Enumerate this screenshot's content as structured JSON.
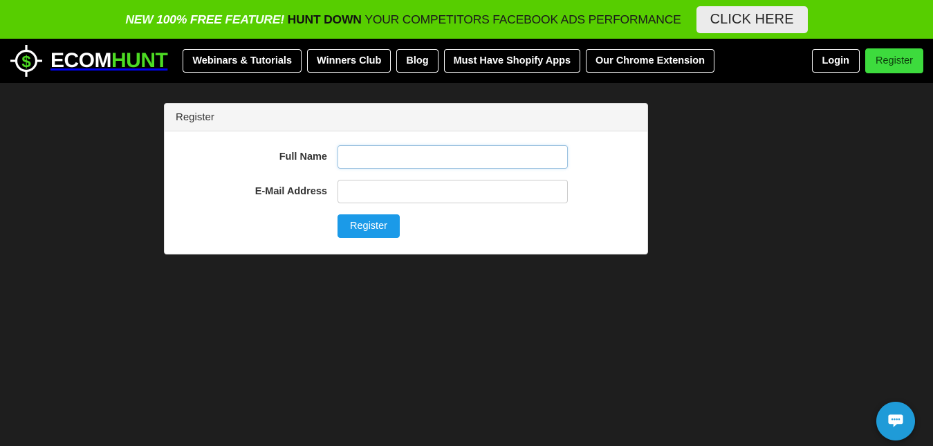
{
  "promo": {
    "new_label": "NEW ",
    "percent_label": "100% FREE ",
    "feature_label": "FEATURE! ",
    "hunt_label": "HUNT DOWN ",
    "rest_label": "YOUR COMPETITORS FACEBOOK ADS PERFORMANCE",
    "cta_label": "CLICK HERE",
    "background_color": "#57ce00"
  },
  "header": {
    "brand": {
      "name_first": "ECOM",
      "name_second": "HUNT",
      "icon": "crosshair-dollar-icon",
      "accent_color": "#4ddb23"
    },
    "nav": [
      {
        "label": "Webinars & Tutorials",
        "name": "nav-webinars-tutorials"
      },
      {
        "label": "Winners Club",
        "name": "nav-winners-club"
      },
      {
        "label": "Blog",
        "name": "nav-blog"
      },
      {
        "label": "Must Have Shopify Apps",
        "name": "nav-must-have-shopify-apps"
      },
      {
        "label": "Our Chrome Extension",
        "name": "nav-our-chrome-extension"
      }
    ],
    "login_label": "Login",
    "register_label": "Register",
    "register_color": "#3ddb3d"
  },
  "register_panel": {
    "title": "Register",
    "fields": [
      {
        "label": "Full Name",
        "value": "",
        "placeholder": "",
        "name": "full-name",
        "focused": true
      },
      {
        "label": "E-Mail Address",
        "value": "",
        "placeholder": "",
        "name": "email-address",
        "focused": false
      }
    ],
    "submit_label": "Register",
    "submit_color": "#1b9ae8"
  },
  "chat": {
    "icon": "chat-bubble-icon",
    "color": "#1f9bd8",
    "dots": 4
  }
}
